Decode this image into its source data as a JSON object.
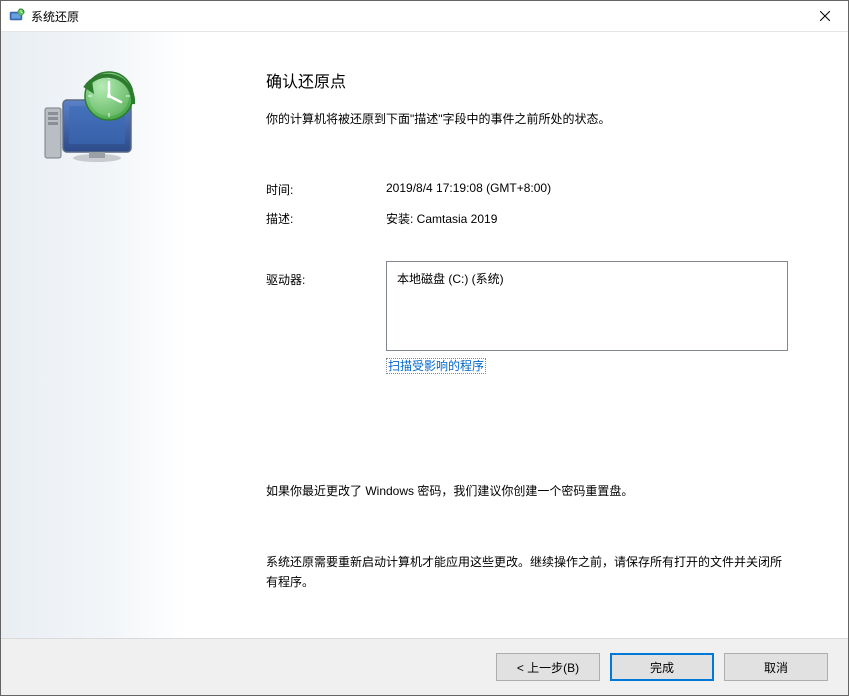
{
  "window": {
    "title": "系统还原"
  },
  "main": {
    "heading": "确认还原点",
    "intro": "你的计算机将被还原到下面\"描述\"字段中的事件之前所处的状态。",
    "time_label": "时间:",
    "time_value": "2019/8/4 17:19:08 (GMT+8:00)",
    "desc_label": "描述:",
    "desc_value": "安装: Camtasia 2019",
    "drives_label": "驱动器:",
    "drive_item0": "本地磁盘 (C:) (系统)",
    "scan_link": "扫描受影响的程序",
    "note_password": "如果你最近更改了 Windows 密码，我们建议你创建一个密码重置盘。",
    "note_restart": "系统还原需要重新启动计算机才能应用这些更改。继续操作之前，请保存所有打开的文件并关闭所有程序。"
  },
  "footer": {
    "back": "< 上一步(B)",
    "finish": "完成",
    "cancel": "取消"
  }
}
